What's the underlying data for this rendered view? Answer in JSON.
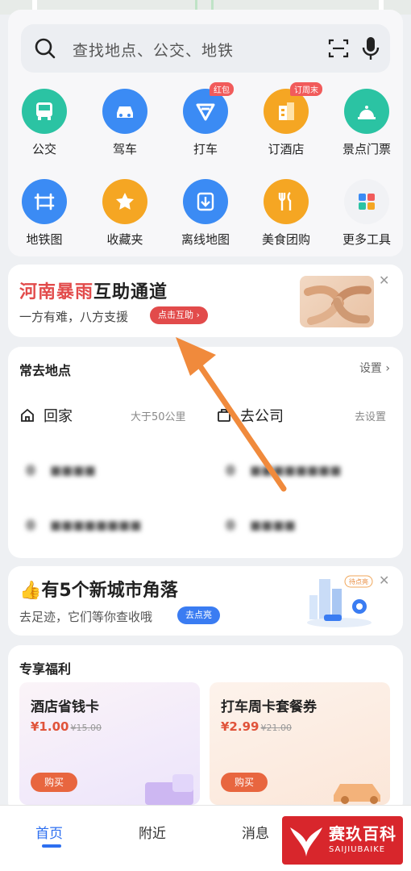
{
  "search": {
    "placeholder": "查找地点、公交、地铁"
  },
  "tools": [
    {
      "label": "公交",
      "icon": "bus-icon",
      "color": "#2bc3a3"
    },
    {
      "label": "驾车",
      "icon": "car-icon",
      "color": "#3b8bf4"
    },
    {
      "label": "打车",
      "icon": "taxi-icon",
      "color": "#3b8bf4",
      "badge": "红包"
    },
    {
      "label": "订酒店",
      "icon": "hotel-icon",
      "color": "#f5a623",
      "badge": "订周末"
    },
    {
      "label": "景点门票",
      "icon": "scenic-icon",
      "color": "#2bc3a3"
    },
    {
      "label": "地铁图",
      "icon": "subway-icon",
      "color": "#3b8bf4"
    },
    {
      "label": "收藏夹",
      "icon": "star-icon",
      "color": "#f5a623"
    },
    {
      "label": "离线地图",
      "icon": "download-icon",
      "color": "#3b8bf4"
    },
    {
      "label": "美食团购",
      "icon": "food-icon",
      "color": "#f5a623"
    },
    {
      "label": "更多工具",
      "icon": "grid-icon",
      "color": "#f1f2f5"
    }
  ],
  "rain": {
    "title_red": "河南暴雨",
    "title_rest": "互助通道",
    "subtitle": "一方有难，八方支援",
    "button": "点击互助 ›"
  },
  "places": {
    "title": "常去地点",
    "settings": "设置",
    "home": {
      "name": "回家",
      "hint": "大于50公里"
    },
    "work": {
      "name": "去公司",
      "hint": "去设置"
    }
  },
  "city": {
    "emoji": "👍",
    "title": "有5个新城市角落",
    "subtitle": "去足迹，它们等你查收哦",
    "button": "去点亮",
    "tag": "待点亮"
  },
  "benefits": {
    "title": "专享福利",
    "items": [
      {
        "title": "酒店省钱卡",
        "price": "¥1.00",
        "old": "¥15.00",
        "button": "购买"
      },
      {
        "title": "打车周卡套餐券",
        "price": "¥2.99",
        "old": "¥21.00",
        "button": "购买"
      }
    ]
  },
  "nav": {
    "items": [
      "首页",
      "附近",
      "消息"
    ]
  },
  "watermark": {
    "brand": "赛玖百科",
    "sub": "SAIJIUBAIKE"
  },
  "colors": {
    "accent": "#2d6ff0",
    "alert": "#e24b4b",
    "arrow": "#f08a3c"
  }
}
